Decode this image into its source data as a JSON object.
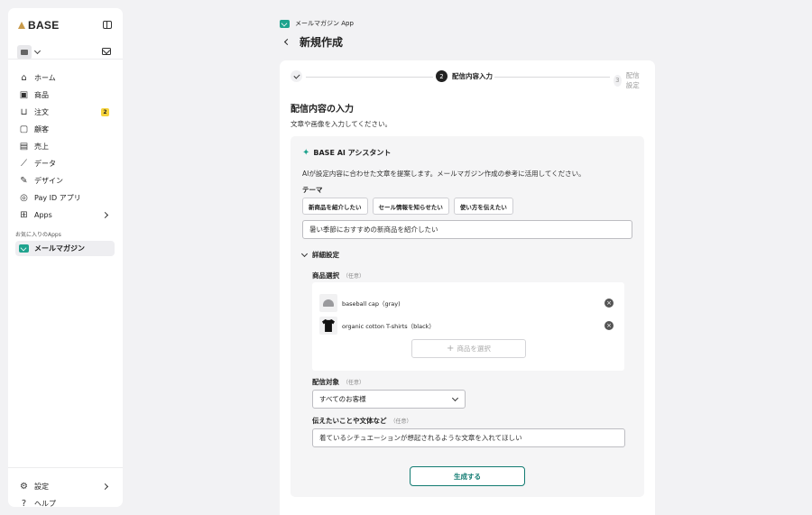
{
  "sidebar": {
    "logo_text": "BASE",
    "nav": [
      {
        "label": "ホーム",
        "icon": "home-icon"
      },
      {
        "label": "商品",
        "icon": "product-icon"
      },
      {
        "label": "注文",
        "icon": "cart-icon",
        "badge": "2"
      },
      {
        "label": "顧客",
        "icon": "customer-icon"
      },
      {
        "label": "売上",
        "icon": "sales-icon"
      },
      {
        "label": "データ",
        "icon": "chart-icon"
      },
      {
        "label": "デザイン",
        "icon": "design-icon"
      },
      {
        "label": "Pay ID アプリ",
        "icon": "payid-icon"
      },
      {
        "label": "Apps",
        "icon": "apps-icon"
      }
    ],
    "favorites_title": "お気に入りのApps",
    "favorite_item": "メールマガジン",
    "settings_label": "設定",
    "help_label": "ヘルプ"
  },
  "header": {
    "app_name": "メールマガジン App",
    "page_title": "新規作成"
  },
  "stepper": {
    "step2_num": "2",
    "step2_label": "配信内容入力",
    "step3_num": "3",
    "step3_label": "配信設定"
  },
  "section": {
    "title": "配信内容の入力",
    "description": "文章や画像を入力してください。"
  },
  "ai": {
    "title": "BASE AI アシスタント",
    "description": "AIが設定内容に合わせた文章を提案します。メールマガジン作成の参考に活用してください。",
    "theme_label": "テーマ",
    "chips": [
      "新商品を紹介したい",
      "セール情報を知らせたい",
      "使い方を伝えたい"
    ],
    "theme_value": "暑い季節におすすめの新商品を紹介したい",
    "detail_label": "詳細設定",
    "product_label": "商品選択",
    "optional": "（任意）",
    "products": [
      {
        "name": "baseball cap（gray)"
      },
      {
        "name": "organic cotton T-shirts（black）"
      }
    ],
    "select_product_label": "商品を選択",
    "target_label": "配信対象",
    "target_value": "すべてのお客様",
    "tone_label": "伝えたいことや文体など",
    "tone_value": "着ているシチュエーションが想起されるような文章を入れてほしい",
    "generate_label": "生成する"
  },
  "colors": {
    "accent": "#1fa38e",
    "button_text": "#127b72",
    "badge": "#f6d33c"
  }
}
